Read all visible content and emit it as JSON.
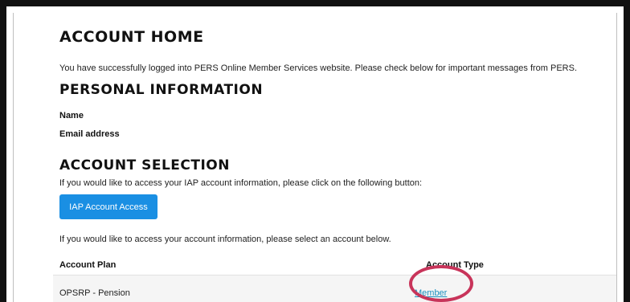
{
  "page": {
    "title": "ACCOUNT HOME",
    "intro": "You have successfully logged into PERS Online Member Services website. Please check below for important messages from PERS."
  },
  "personal": {
    "heading": "PERSONAL INFORMATION",
    "name_label": "Name",
    "email_label": "Email address"
  },
  "account_selection": {
    "heading": "ACCOUNT SELECTION",
    "iap_prompt": "If you would like to access your IAP account information, please click on the following button:",
    "iap_button": "IAP Account Access",
    "account_prompt": "If you would like to access your account information, please select an account below."
  },
  "table": {
    "columns": [
      "Account Plan",
      "Account Type"
    ],
    "rows": [
      {
        "plan": "OPSRP - Pension",
        "type": "Member"
      }
    ]
  },
  "colors": {
    "button": "#1a8fe3",
    "link": "#1a8fbf",
    "highlight": "#c8345a"
  }
}
